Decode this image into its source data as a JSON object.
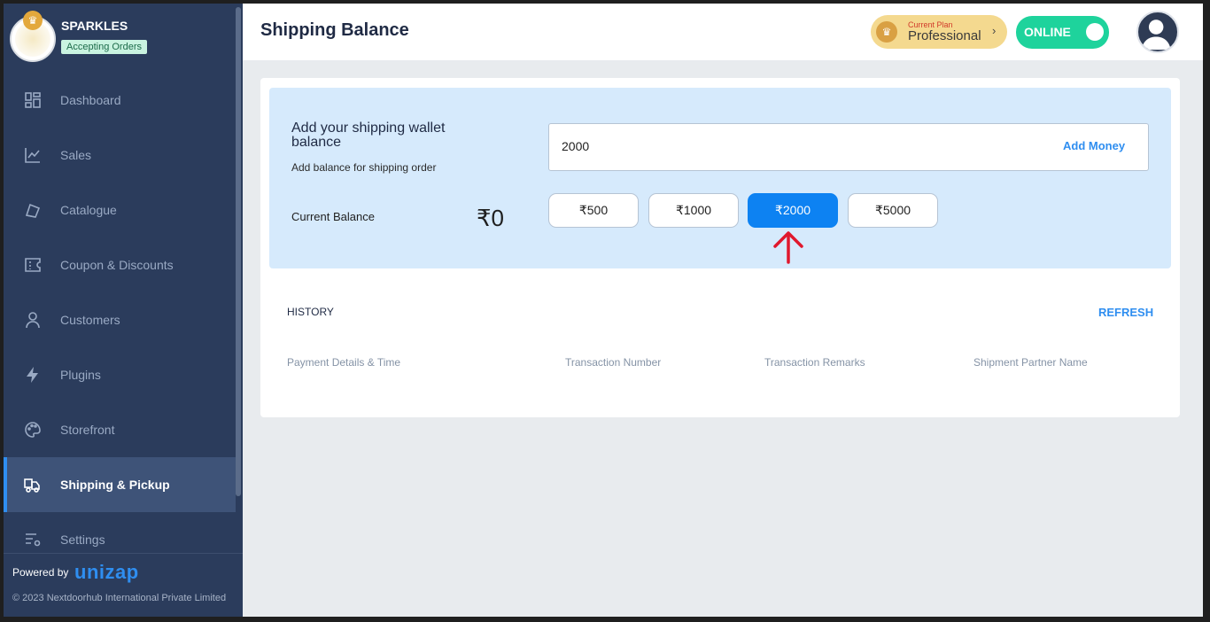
{
  "store": {
    "name": "SPARKLES",
    "status_badge": "Accepting Orders"
  },
  "sidebar": {
    "items": [
      {
        "label": "Dashboard",
        "icon": "dashboard-icon"
      },
      {
        "label": "Sales",
        "icon": "chart-line-icon"
      },
      {
        "label": "Catalogue",
        "icon": "catalogue-icon"
      },
      {
        "label": "Coupon & Discounts",
        "icon": "coupon-icon"
      },
      {
        "label": "Customers",
        "icon": "user-icon"
      },
      {
        "label": "Plugins",
        "icon": "bolt-icon"
      },
      {
        "label": "Storefront",
        "icon": "palette-icon"
      },
      {
        "label": "Shipping & Pickup",
        "icon": "shipping-icon",
        "active": true
      },
      {
        "label": "Settings",
        "icon": "settings-icon"
      }
    ],
    "powered_by": "Powered by",
    "powered_brand": "unizap",
    "copyright": "© 2023 Nextdoorhub International Private Limited"
  },
  "header": {
    "title": "Shipping Balance",
    "plan_label": "Current Plan",
    "plan_name": "Professional",
    "plan_chevron": "›",
    "online_label": "ONLINE"
  },
  "wallet": {
    "title": "Add your shipping wallet balance",
    "subtitle": "Add balance for shipping order",
    "amount_value": "2000",
    "add_money_label": "Add Money",
    "balance_label": "Current Balance",
    "balance_value": "₹0",
    "presets": [
      "₹500",
      "₹1000",
      "₹2000",
      "₹5000"
    ],
    "selected_preset": "₹2000"
  },
  "history": {
    "label": "HISTORY",
    "refresh_label": "REFRESH",
    "columns": [
      "Payment Details & Time",
      "Transaction Number",
      "Transaction Remarks",
      "Shipment Partner Name"
    ]
  },
  "colors": {
    "sidebar": "#2b3c5c",
    "accent": "#2f8ef0",
    "online": "#1ed39c",
    "wallet_bg": "#d6eafc"
  }
}
